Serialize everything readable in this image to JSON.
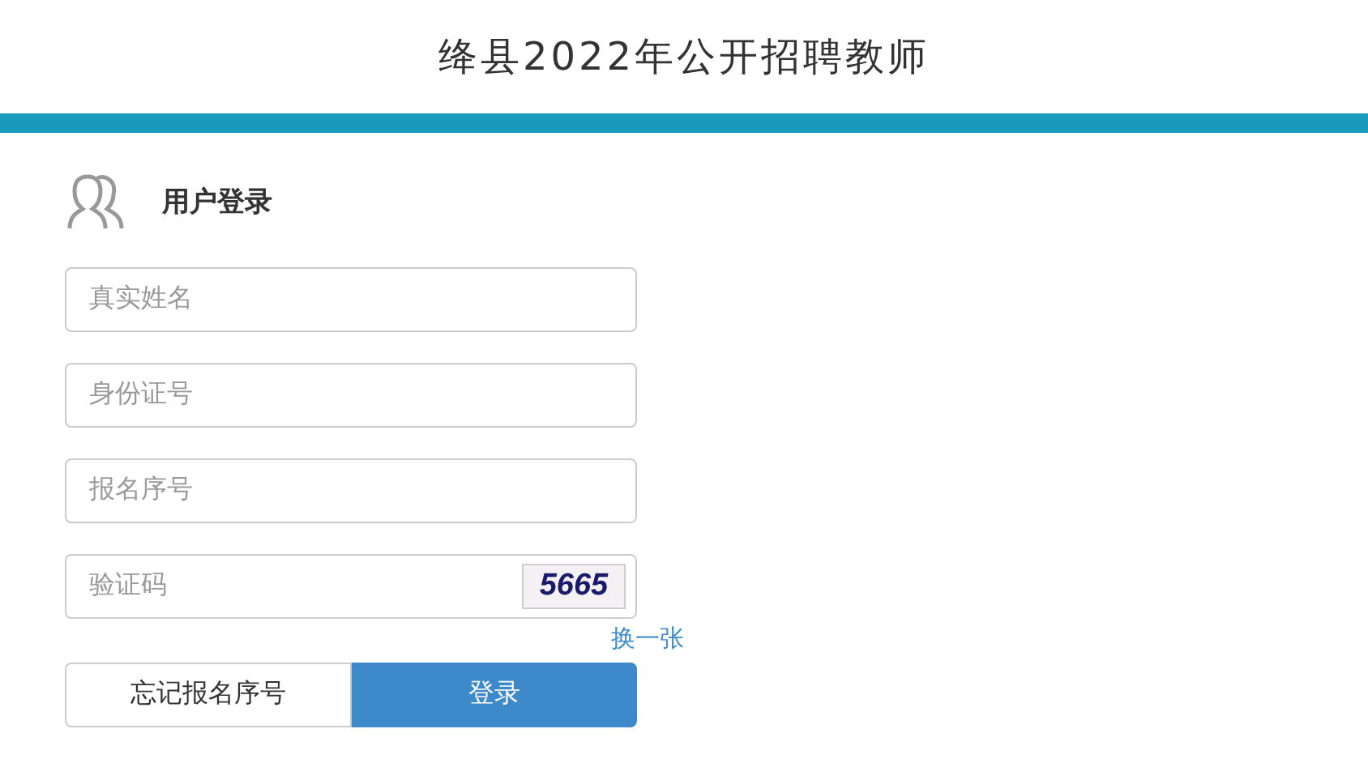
{
  "header": {
    "title": "绛县2022年公开招聘教师"
  },
  "login": {
    "title": "用户登录",
    "fields": [
      {
        "placeholder": "真实姓名"
      },
      {
        "placeholder": "身份证号"
      },
      {
        "placeholder": "报名序号"
      }
    ],
    "captcha": {
      "placeholder": "验证码",
      "code": "5665",
      "refresh": "换一张"
    },
    "buttons": [
      {
        "label": "忘记报名序号",
        "kind": "secondary"
      },
      {
        "label": "登录",
        "kind": "primary"
      }
    ]
  }
}
